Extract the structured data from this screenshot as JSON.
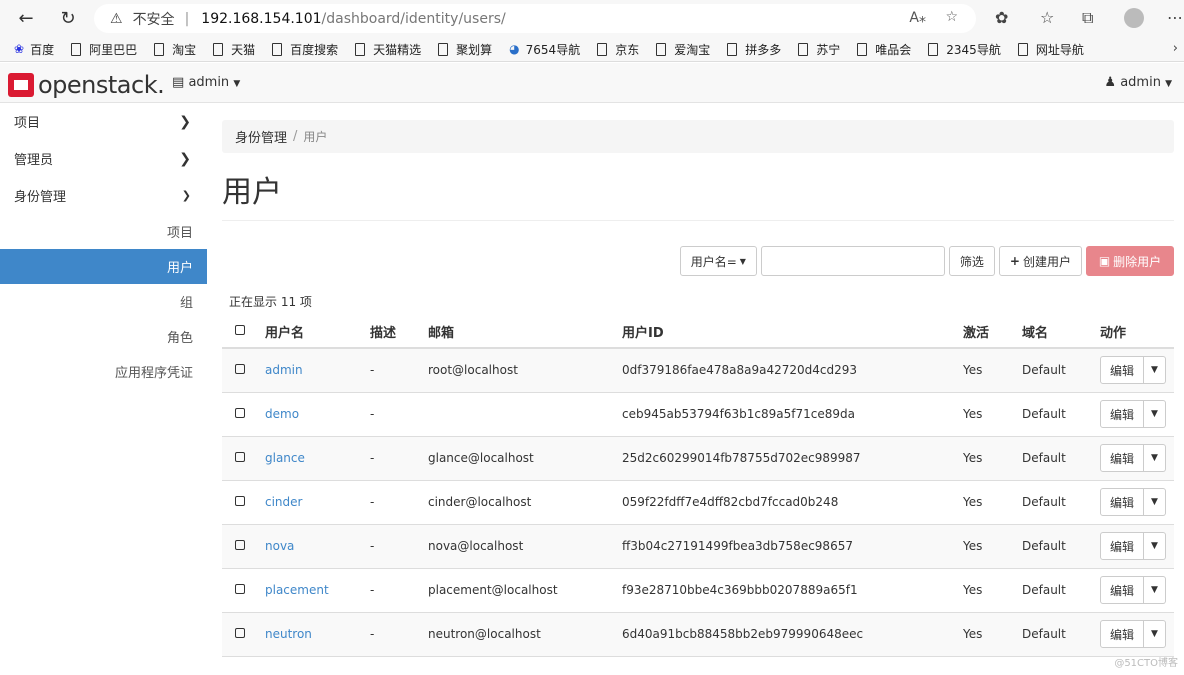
{
  "browser": {
    "insecure_label": "不安全",
    "url_host": "192.168.154.101",
    "url_path": "/dashboard/identity/users/",
    "bookmarks": [
      "百度",
      "阿里巴巴",
      "淘宝",
      "天猫",
      "百度搜索",
      "天猫精选",
      "聚划算",
      "7654导航",
      "京东",
      "爱淘宝",
      "拼多多",
      "苏宁",
      "唯品会",
      "2345导航",
      "网址导航"
    ]
  },
  "header": {
    "logo_text": "openstack.",
    "project": "admin",
    "user": "admin"
  },
  "sidebar": {
    "items": [
      {
        "label": "项目"
      },
      {
        "label": "管理员"
      },
      {
        "label": "身份管理"
      }
    ],
    "subitems": [
      {
        "label": "项目"
      },
      {
        "label": "用户"
      },
      {
        "label": "组"
      },
      {
        "label": "角色"
      },
      {
        "label": "应用程序凭证"
      }
    ]
  },
  "breadcrumb": {
    "parent": "身份管理",
    "current": "用户"
  },
  "page_title": "用户",
  "toolbar": {
    "filter_select": "用户名=",
    "filter_button": "筛选",
    "create_button": "创建用户",
    "delete_button": "删除用户"
  },
  "count_text": "正在显示 11 项",
  "table": {
    "headers": [
      "用户名",
      "描述",
      "邮箱",
      "用户ID",
      "激活",
      "域名",
      "动作"
    ],
    "rows": [
      {
        "name": "admin",
        "desc": "-",
        "email": "root@localhost",
        "id": "0df379186fae478a8a9a42720d4cd293",
        "active": "Yes",
        "domain": "Default",
        "action": "编辑"
      },
      {
        "name": "demo",
        "desc": "-",
        "email": "",
        "id": "ceb945ab53794f63b1c89a5f71ce89da",
        "active": "Yes",
        "domain": "Default",
        "action": "编辑"
      },
      {
        "name": "glance",
        "desc": "-",
        "email": "glance@localhost",
        "id": "25d2c60299014fb78755d702ec989987",
        "active": "Yes",
        "domain": "Default",
        "action": "编辑"
      },
      {
        "name": "cinder",
        "desc": "-",
        "email": "cinder@localhost",
        "id": "059f22fdff7e4dff82cbd7fccad0b248",
        "active": "Yes",
        "domain": "Default",
        "action": "编辑"
      },
      {
        "name": "nova",
        "desc": "-",
        "email": "nova@localhost",
        "id": "ff3b04c27191499fbea3db758ec98657",
        "active": "Yes",
        "domain": "Default",
        "action": "编辑"
      },
      {
        "name": "placement",
        "desc": "-",
        "email": "placement@localhost",
        "id": "f93e28710bbe4c369bbb0207889a65f1",
        "active": "Yes",
        "domain": "Default",
        "action": "编辑"
      },
      {
        "name": "neutron",
        "desc": "-",
        "email": "neutron@localhost",
        "id": "6d40a91bcb88458bb2eb979990648eec",
        "active": "Yes",
        "domain": "Default",
        "action": "编辑"
      }
    ]
  },
  "watermark": "@51CTO博客"
}
